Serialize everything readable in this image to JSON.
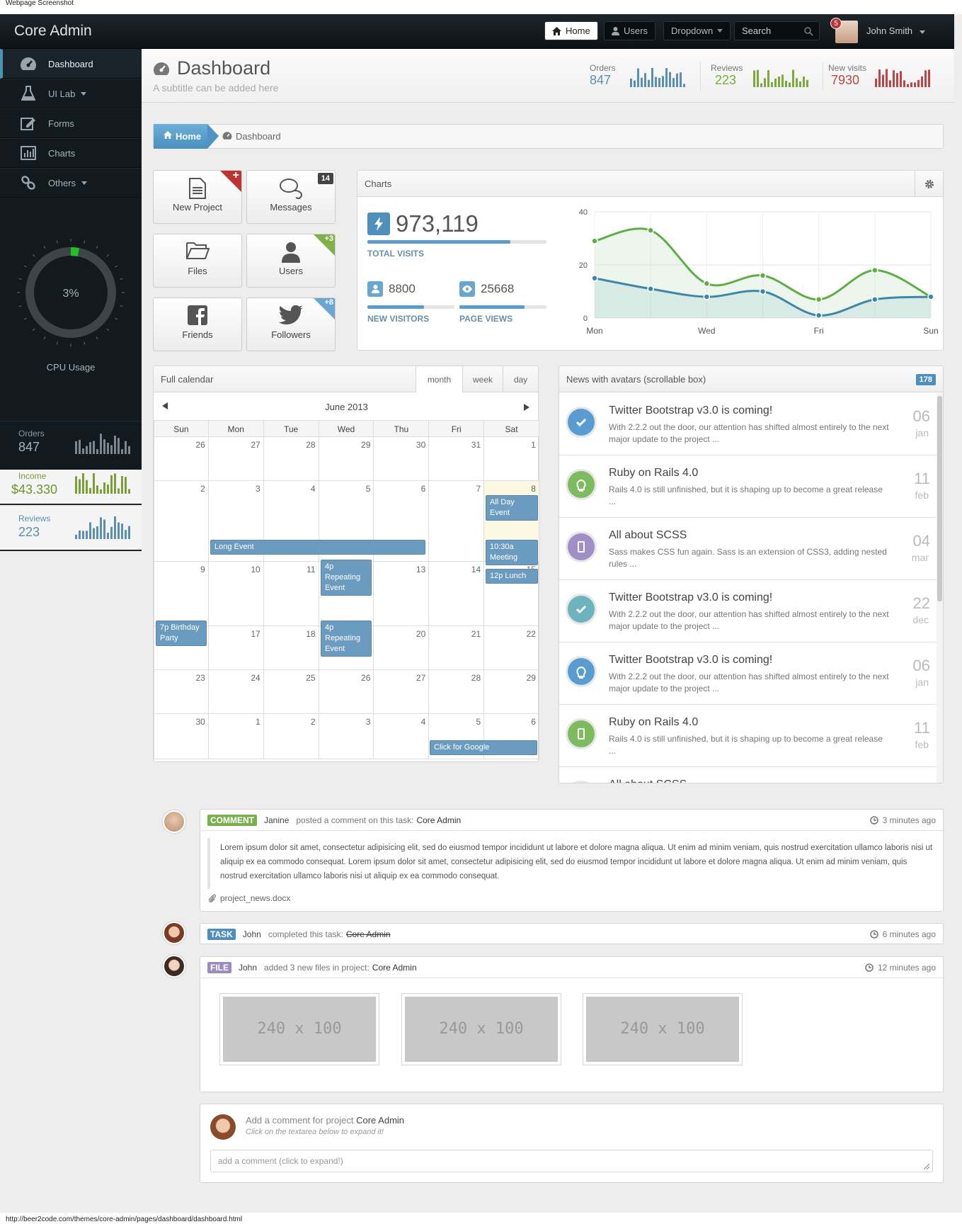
{
  "caption": "Webpage Screenshot",
  "statusbar": "http://beer2code.com/themes/core-admin/pages/dashboard/dashboard.html",
  "navbar": {
    "brand": "Core Admin",
    "home": "Home",
    "users": "Users",
    "dropdown": "Dropdown",
    "search_placeholder": "Search",
    "notifications": "5",
    "user": "John Smith"
  },
  "sidebar": {
    "items": [
      {
        "label": "Dashboard"
      },
      {
        "label": "UI Lab"
      },
      {
        "label": "Forms"
      },
      {
        "label": "Charts"
      },
      {
        "label": "Others"
      }
    ],
    "cpu_value": "3%",
    "cpu_fraction": 0.03,
    "cpu_label": "CPU Usage",
    "stats": [
      {
        "label": "Orders",
        "value": "847"
      },
      {
        "label": "Income",
        "value": "$43.330"
      },
      {
        "label": "Reviews",
        "value": "223"
      }
    ]
  },
  "header": {
    "title": "Dashboard",
    "subtitle": "A subtitle can be added here",
    "stats": [
      {
        "label": "Orders",
        "value": "847",
        "color": "#5b8fad"
      },
      {
        "label": "Reviews",
        "value": "223",
        "color": "#7fa83c"
      },
      {
        "label": "New visits",
        "value": "7930",
        "color": "#b94747"
      }
    ]
  },
  "breadcrumb": {
    "home": "Home",
    "current": "Dashboard"
  },
  "tiles": [
    {
      "label": "New Project",
      "badge": "+"
    },
    {
      "label": "Messages",
      "badge": "14"
    },
    {
      "label": "Files",
      "badge": ""
    },
    {
      "label": "Users",
      "badge": "+3"
    },
    {
      "label": "Friends",
      "badge": ""
    },
    {
      "label": "Followers",
      "badge": "+8"
    }
  ],
  "charts_panel": {
    "title": "Charts",
    "total": "973,119",
    "total_label": "TOTAL VISITS",
    "total_fraction": 0.8,
    "visitors": "8800",
    "visitors_label": "NEW VISITORS",
    "visitors_fraction": 0.65,
    "pageviews": "25668",
    "pageviews_label": "PAGE VIEWS",
    "pageviews_fraction": 0.75
  },
  "chart_data": {
    "type": "area",
    "x": [
      "Mon",
      "Tue",
      "Wed",
      "Thu",
      "Fri",
      "Sat",
      "Sun"
    ],
    "xticks": [
      "Mon",
      "Wed",
      "Fri",
      "Sun"
    ],
    "yticks": [
      "40",
      "20",
      "0"
    ],
    "ylim": [
      0,
      40
    ],
    "series": [
      {
        "values": [
          29,
          33,
          13,
          16,
          7,
          18,
          8
        ],
        "color": "#5fad46"
      },
      {
        "values": [
          15,
          11,
          8,
          10,
          1,
          7,
          8
        ],
        "color": "#3f87a8"
      }
    ],
    "grid": true
  },
  "calendar": {
    "title": "Full calendar",
    "views": [
      "month",
      "week",
      "day"
    ],
    "active_view": "month",
    "month": "June 2013",
    "weekdays": [
      "Sun",
      "Mon",
      "Tue",
      "Wed",
      "Thu",
      "Fri",
      "Sat"
    ],
    "weeks": [
      [
        "26",
        "27",
        "28",
        "29",
        "30",
        "31",
        "1"
      ],
      [
        "2",
        "3",
        "4",
        "5",
        "6",
        "7",
        "8"
      ],
      [
        "9",
        "10",
        "11",
        "12",
        "13",
        "14",
        "15"
      ],
      [
        "16",
        "17",
        "18",
        "19",
        "20",
        "21",
        "22"
      ],
      [
        "23",
        "24",
        "25",
        "26",
        "27",
        "28",
        "29"
      ],
      [
        "30",
        "1",
        "2",
        "3",
        "4",
        "5",
        "6"
      ]
    ],
    "events": {
      "allday": "All Day Event",
      "long": "Long Event",
      "rep1": "4p Repeating Event",
      "meeting": "10:30a Meeting",
      "lunch": "12p Lunch",
      "birthday": "7p Birthday Party",
      "rep2": "4p Repeating Event",
      "google": "Click for Google"
    }
  },
  "news": {
    "title": "News with avatars (scrollable box)",
    "count": "178",
    "items": [
      {
        "title": "Twitter Bootstrap v3.0 is coming!",
        "text": "With 2.2.2 out the door, our attention has shifted almost entirely to the next major update to the project ...",
        "day": "06",
        "month": "jan",
        "color": "#5a9cd0"
      },
      {
        "title": "Ruby on Rails 4.0",
        "text": "Rails 4.0 is still unfinished, but it is shaping up to become a great release ...",
        "day": "11",
        "month": "feb",
        "color": "#7dbb5e"
      },
      {
        "title": "All about SCSS",
        "text": "Sass makes CSS fun again. Sass is an extension of CSS3, adding nested rules ...",
        "day": "04",
        "month": "mar",
        "color": "#a08ec7"
      },
      {
        "title": "Twitter Bootstrap v3.0 is coming!",
        "text": "With 2.2.2 out the door, our attention has shifted almost entirely to the next major update to the project ...",
        "day": "22",
        "month": "dec",
        "color": "#6cb3bd"
      },
      {
        "title": "Twitter Bootstrap v3.0 is coming!",
        "text": "With 2.2.2 out the door, our attention has shifted almost entirely to the next major update to the project ...",
        "day": "06",
        "month": "jan",
        "color": "#5a9cd0"
      },
      {
        "title": "Ruby on Rails 4.0",
        "text": "Rails 4.0 is still unfinished, but it is shaping up to become a great release ...",
        "day": "11",
        "month": "feb",
        "color": "#7dbb5e"
      },
      {
        "title": "All about SCSS",
        "text": "",
        "day": "",
        "month": "",
        "color": "#a08ec7"
      }
    ]
  },
  "timeline": {
    "comment": {
      "label": "COMMENT",
      "user": "Janine",
      "action": "posted a comment on this task:",
      "project": "Core Admin",
      "time": "3 minutes ago",
      "body": "Lorem ipsum dolor sit amet, consectetur adipisicing elit, sed do eiusmod tempor incididunt ut labore et dolore magna aliqua. Ut enim ad minim veniam, quis nostrud exercitation ullamco laboris nisi ut aliquip ex ea commodo consequat. Lorem ipsum dolor sit amet, consectetur adipisicing elit, sed do eiusmod tempor incididunt ut labore et dolore magna aliqua. Ut enim ad minim veniam, quis nostrud exercitation ullamco laboris nisi ut aliquip ex ea commodo consequat.",
      "attachment": "project_news.docx"
    },
    "task": {
      "label": "TASK",
      "user": "John",
      "action": "completed this task:",
      "project": "Core Admin",
      "time": "6 minutes ago"
    },
    "file": {
      "label": "FILE",
      "user": "John",
      "action": "added 3 new files in project:",
      "project": "Core Admin",
      "time": "12 minutes ago",
      "placeholder": "240 x 100"
    },
    "add": {
      "title_prefix": "Add a comment for project",
      "project": "Core Admin",
      "hint": "Click on the textarea below to expand it!",
      "placeholder": "add a comment (click to expand!)"
    }
  }
}
